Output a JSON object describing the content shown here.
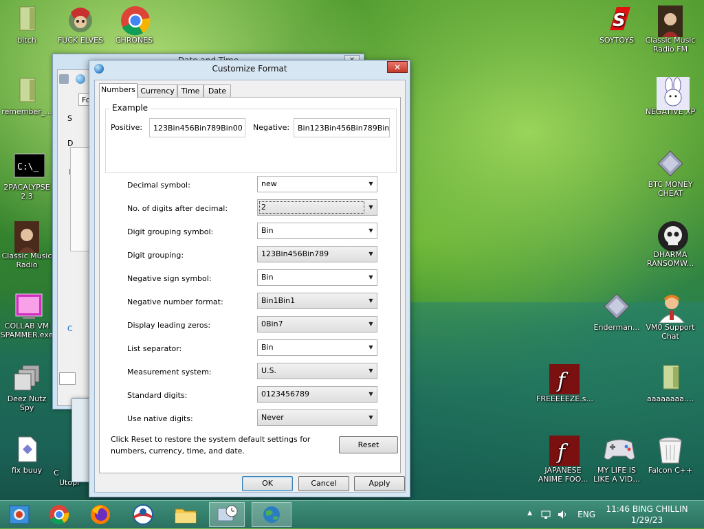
{
  "desktop": {
    "icons": [
      {
        "label": "bitch",
        "icon": "folder-icon"
      },
      {
        "label": "FUCK ELVES",
        "icon": "elf-avatar-icon"
      },
      {
        "label": "CHRONES",
        "icon": "chrome-icon"
      },
      {
        "label": "remember_...",
        "icon": "folder-icon"
      },
      {
        "label": "2PACALYPSE 2.3",
        "icon": "terminal-icon"
      },
      {
        "label": "Classic Music Radio",
        "icon": "portrait-icon"
      },
      {
        "label": "COLLAB VM SPAMMER.exe",
        "icon": "app-window-icon"
      },
      {
        "label": "Deez Nutz Spy",
        "icon": "windows-stack-icon"
      },
      {
        "label": "fix buuy",
        "icon": "document-icon"
      },
      {
        "label": "SOYTOYS",
        "icon": "soytoys-logo-icon"
      },
      {
        "label": "Classic Music Radio FM",
        "icon": "portrait-icon"
      },
      {
        "label": "NEGATIVE XP",
        "icon": "bunny-icon"
      },
      {
        "label": "BTC MONEY CHEAT",
        "icon": "diamond-icon"
      },
      {
        "label": "DHARMA RANSOMW...",
        "icon": "skull-icon"
      },
      {
        "label": "Enderman...",
        "icon": "diamond-icon"
      },
      {
        "label": "VM0 Support Chat",
        "icon": "support-agent-icon"
      },
      {
        "label": "FREEEEEZE.s...",
        "icon": "flash-icon"
      },
      {
        "label": "aaaaaaaa....",
        "icon": "folder-icon"
      },
      {
        "label": "JAPANESE ANIME FOO...",
        "icon": "flash-icon"
      },
      {
        "label": "MY LIFE IS LIKE A VID...",
        "icon": "gamepad-icon"
      },
      {
        "label": "Falcon C++",
        "icon": "recycle-bin-icon"
      }
    ],
    "partial_labels": {
      "c": "C",
      "utopi": "Utopi"
    }
  },
  "back_window": {
    "title": "Date and Time",
    "tab_fragment": "Fo",
    "fragments": {
      "s": "S",
      "d": "D",
      "l": "L",
      "c": "C"
    }
  },
  "dialog": {
    "title": "Customize Format",
    "close_label": "✕",
    "tabs": [
      "Numbers",
      "Currency",
      "Time",
      "Date"
    ],
    "example": {
      "legend": "Example",
      "positive_label": "Positive:",
      "positive_value": "123Bin456Bin789Bin00",
      "negative_label": "Negative:",
      "negative_value": "Bin123Bin456Bin789Bin"
    },
    "settings": [
      {
        "label": "Decimal symbol:",
        "value": "new",
        "style": "edit"
      },
      {
        "label": "No. of digits after decimal:",
        "value": "2",
        "style": "dropdown"
      },
      {
        "label": "Digit grouping symbol:",
        "value": "Bin",
        "style": "edit"
      },
      {
        "label": "Digit grouping:",
        "value": "123Bin456Bin789",
        "style": "dropdown"
      },
      {
        "label": "Negative sign symbol:",
        "value": "Bin",
        "style": "edit"
      },
      {
        "label": "Negative number format:",
        "value": "Bin1Bin1",
        "style": "dropdown"
      },
      {
        "label": "Display leading zeros:",
        "value": "0Bin7",
        "style": "dropdown"
      },
      {
        "label": "List separator:",
        "value": "Bin",
        "style": "edit"
      },
      {
        "label": "Measurement system:",
        "value": "U.S.",
        "style": "dropdown"
      },
      {
        "label": "Standard digits:",
        "value": "0123456789",
        "style": "dropdown"
      },
      {
        "label": "Use native digits:",
        "value": "Never",
        "style": "dropdown"
      }
    ],
    "reset_note": "Click Reset to restore the system default settings for numbers, currency, time, and date.",
    "reset_label": "Reset",
    "ok_label": "OK",
    "cancel_label": "Cancel",
    "apply_label": "Apply"
  },
  "taskbar": {
    "buttons": [
      "windows-store-icon",
      "chrome-icon",
      "firefox-icon",
      "obama-logo-icon",
      "file-explorer-icon",
      "control-panel-icon",
      "region-globe-icon"
    ],
    "language": "ENG",
    "time": "11:46 BING CHILLIN",
    "date": "1/29/23"
  }
}
